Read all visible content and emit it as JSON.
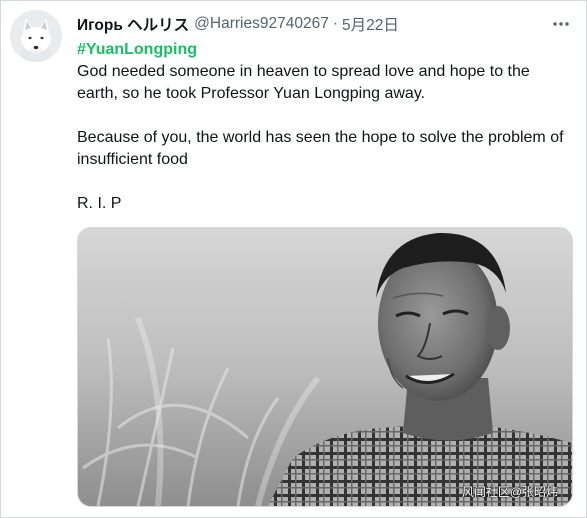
{
  "tweet": {
    "display_name": "Игорь ヘルリス",
    "handle": "@Harries92740267",
    "separator": "·",
    "date": "5月22日",
    "more_icon": "more-horizontal-icon",
    "hashtag": "#YuanLongping",
    "paragraphs": [
      "God needed someone in heaven to spread love and hope to the earth, so he took Professor Yuan Longping away.",
      "Because of you, the world has seen the hope to solve the problem of insufficient food",
      "R. I. P"
    ],
    "media": {
      "watermark": "风闻社区@张昭炜"
    }
  },
  "colors": {
    "hashtag": "#17bf63",
    "secondary_text": "#536471",
    "border": "#cfd9de"
  }
}
